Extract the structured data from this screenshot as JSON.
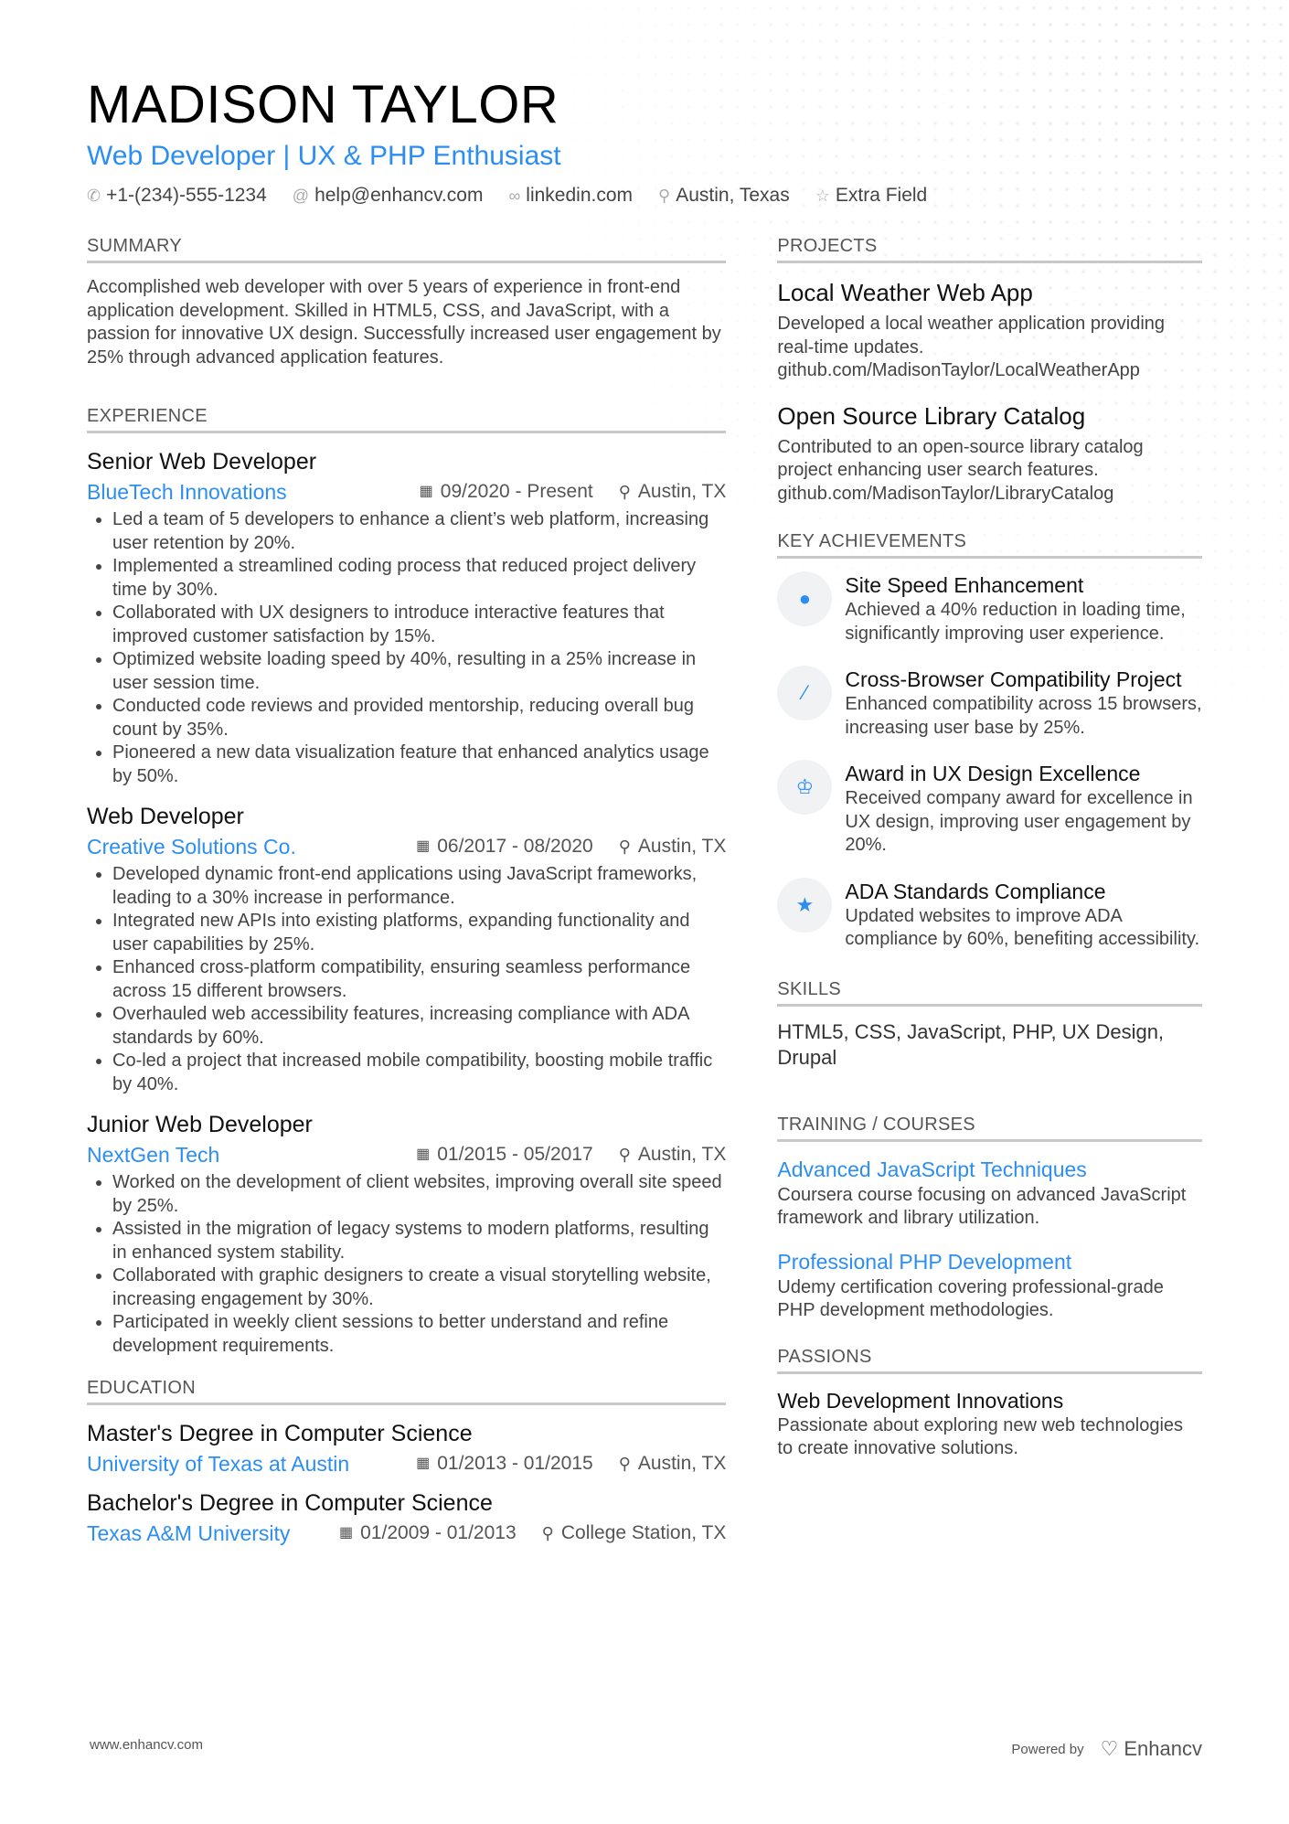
{
  "header": {
    "name": "MADISON TAYLOR",
    "title": "Web Developer | UX & PHP Enthusiast",
    "contacts": [
      {
        "icon": "phone-icon",
        "text": "+1-(234)-555-1234"
      },
      {
        "icon": "at-icon",
        "text": "help@enhancv.com"
      },
      {
        "icon": "link-icon",
        "text": "linkedin.com"
      },
      {
        "icon": "location-icon",
        "text": "Austin, Texas"
      },
      {
        "icon": "star-icon",
        "text": "Extra Field"
      }
    ]
  },
  "summary": {
    "heading": "SUMMARY",
    "text": "Accomplished web developer with over 5 years of experience in front-end application development. Skilled in HTML5, CSS, and JavaScript, with a passion for innovative UX design. Successfully increased user engagement by 25% through advanced application features."
  },
  "experience": {
    "heading": "EXPERIENCE",
    "jobs": [
      {
        "title": "Senior Web Developer",
        "company": "BlueTech Innovations",
        "dates": "09/2020 - Present",
        "location": "Austin, TX",
        "bullets": [
          "Led a team of 5 developers to enhance a client’s web platform, increasing user retention by 20%.",
          "Implemented a streamlined coding process that reduced project delivery time by 30%.",
          "Collaborated with UX designers to introduce interactive features that improved customer satisfaction by 15%.",
          "Optimized website loading speed by 40%, resulting in a 25% increase in user session time.",
          "Conducted code reviews and provided mentorship, reducing overall bug count by 35%.",
          "Pioneered a new data visualization feature that enhanced analytics usage by 50%."
        ]
      },
      {
        "title": "Web Developer",
        "company": "Creative Solutions Co.",
        "dates": "06/2017 - 08/2020",
        "location": "Austin, TX",
        "bullets": [
          "Developed dynamic front-end applications using JavaScript frameworks, leading to a 30% increase in performance.",
          "Integrated new APIs into existing platforms, expanding functionality and user capabilities by 25%.",
          "Enhanced cross-platform compatibility, ensuring seamless performance across 15 different browsers.",
          "Overhauled web accessibility features, increasing compliance with ADA standards by 60%.",
          "Co-led a project that increased mobile compatibility, boosting mobile traffic by 40%."
        ]
      },
      {
        "title": "Junior Web Developer",
        "company": "NextGen Tech",
        "dates": "01/2015 - 05/2017",
        "location": "Austin, TX",
        "bullets": [
          "Worked on the development of client websites, improving overall site speed by 25%.",
          "Assisted in the migration of legacy systems to modern platforms, resulting in enhanced system stability.",
          "Collaborated with graphic designers to create a visual storytelling website, increasing engagement by 30%.",
          "Participated in weekly client sessions to better understand and refine development requirements."
        ]
      }
    ]
  },
  "education": {
    "heading": "EDUCATION",
    "items": [
      {
        "degree": "Master's Degree in Computer Science",
        "school": "University of Texas at Austin",
        "dates": "01/2013 - 01/2015",
        "location": "Austin, TX"
      },
      {
        "degree": "Bachelor's Degree in Computer Science",
        "school": "Texas A&M University",
        "dates": "01/2009 - 01/2013",
        "location": "College Station, TX"
      }
    ]
  },
  "projects": {
    "heading": "PROJECTS",
    "items": [
      {
        "title": "Local Weather Web App",
        "text": "Developed a local weather application providing real-time updates. github.com/MadisonTaylor/LocalWeatherApp"
      },
      {
        "title": "Open Source Library Catalog",
        "text": "Contributed to an open-source library catalog project enhancing user search features. github.com/MadisonTaylor/LibraryCatalog"
      }
    ]
  },
  "achievements": {
    "heading": "KEY ACHIEVEMENTS",
    "items": [
      {
        "icon": "brain-icon",
        "glyph": "●",
        "title": "Site Speed Enhancement",
        "text": "Achieved a 40% reduction in loading time, significantly improving user experience."
      },
      {
        "icon": "magic-wand-icon",
        "glyph": "⁄",
        "title": "Cross-Browser Compatibility Project",
        "text": "Enhanced compatibility across 15 browsers, increasing user base by 25%."
      },
      {
        "icon": "trophy-icon",
        "glyph": "♔",
        "title": "Award in UX Design Excellence",
        "text": "Received company award for excellence in UX design, improving user engagement by 20%."
      },
      {
        "icon": "star-half-icon",
        "glyph": "★",
        "title": "ADA Standards Compliance",
        "text": "Updated websites to improve ADA compliance by 60%, benefiting accessibility."
      }
    ]
  },
  "skills": {
    "heading": "SKILLS",
    "text": "HTML5, CSS, JavaScript, PHP, UX Design, Drupal"
  },
  "training": {
    "heading": "TRAINING / COURSES",
    "items": [
      {
        "title": "Advanced JavaScript Techniques",
        "text": "Coursera course focusing on advanced JavaScript framework and library utilization."
      },
      {
        "title": "Professional PHP Development",
        "text": "Udemy certification covering professional-grade PHP development methodologies."
      }
    ]
  },
  "passions": {
    "heading": "PASSIONS",
    "items": [
      {
        "title": "Web Development Innovations",
        "text": "Passionate about exploring new web technologies to create innovative solutions."
      }
    ]
  },
  "footer": {
    "url": "www.enhancv.com",
    "powered": "Powered by",
    "brand": "Enhancv"
  }
}
